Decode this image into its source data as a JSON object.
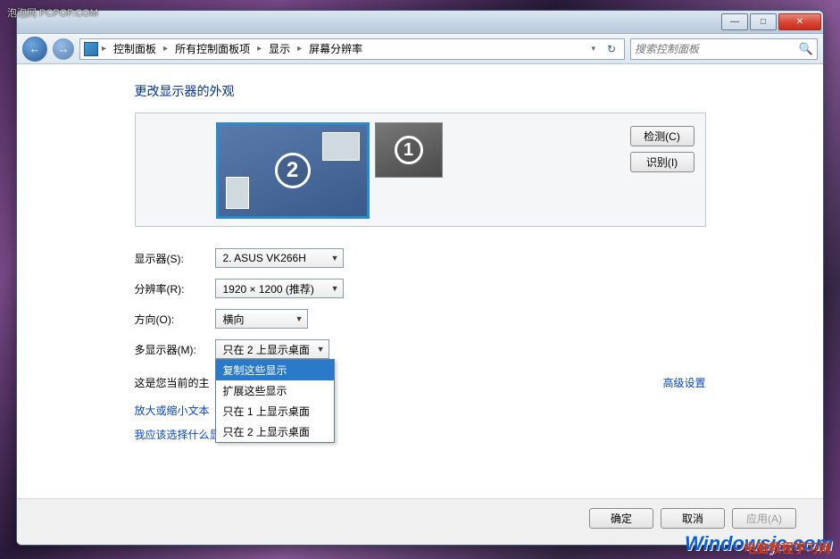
{
  "watermarks": {
    "top_left": "泡泡网 PCPOP.COM",
    "bottom_right": "Windowsjc.com",
    "bottom_right2": "电脑教程学习网"
  },
  "titlebar": {
    "minimize": "—",
    "maximize": "□",
    "close": "✕"
  },
  "navbar": {
    "back": "←",
    "forward": "→",
    "breadcrumb": [
      "控制面板",
      "所有控制面板项",
      "显示",
      "屏幕分辨率"
    ],
    "refresh": "↻",
    "search_placeholder": "搜索控制面板"
  },
  "page": {
    "title": "更改显示器的外观",
    "monitors": {
      "primary_num": "2",
      "secondary_num": "1"
    },
    "detect_btn": "检测(C)",
    "identify_btn": "识别(I)",
    "labels": {
      "display": "显示器(S):",
      "resolution": "分辨率(R):",
      "orientation": "方向(O):",
      "multi": "多显示器(M):"
    },
    "values": {
      "display": "2. ASUS VK266H",
      "resolution": "1920 × 1200 (推荐)",
      "orientation": "横向",
      "multi": "只在 2 上显示桌面"
    },
    "multi_options": [
      "复制这些显示",
      "扩展这些显示",
      "只在 1 上显示桌面",
      "只在 2 上显示桌面"
    ],
    "main_display_text_prefix": "这是您当前的主",
    "advanced_link": "高级设置",
    "text_size_link": "放大或缩小文本",
    "which_display_link": "我应该选择什么显示器设置？"
  },
  "footer": {
    "ok": "确定",
    "cancel": "取消",
    "apply": "应用(A)"
  }
}
